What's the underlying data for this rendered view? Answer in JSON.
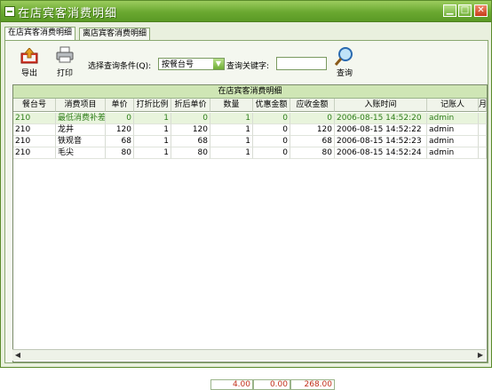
{
  "window": {
    "title": "在店宾客消费明细"
  },
  "tabs": [
    {
      "label": "在店宾客消费明细",
      "active": true
    },
    {
      "label": "离店宾客消费明细",
      "active": false
    }
  ],
  "toolbar": {
    "export_label": "导出",
    "print_label": "打印",
    "condition_label": "选择查询条件(Q):",
    "condition_value": "按餐台号",
    "keyword_label": "查询关键字:",
    "keyword_value": "",
    "query_label": "查询"
  },
  "grid": {
    "caption": "在店宾客消费明细",
    "columns": [
      "餐台号",
      "消费项目",
      "单价",
      "打折比例",
      "折后单价",
      "数量",
      "优惠金额",
      "应收金额",
      "入账时间",
      "记账人",
      "月"
    ],
    "rows": [
      [
        "210",
        "最低消费补差",
        "0",
        "1",
        "0",
        "1",
        "0",
        "0",
        "2006-08-15 14:52:20",
        "admin"
      ],
      [
        "210",
        "龙井",
        "120",
        "1",
        "120",
        "1",
        "0",
        "120",
        "2006-08-15 14:52:22",
        "admin"
      ],
      [
        "210",
        "铁观音",
        "68",
        "1",
        "68",
        "1",
        "0",
        "68",
        "2006-08-15 14:52:23",
        "admin"
      ],
      [
        "210",
        "毛尖",
        "80",
        "1",
        "80",
        "1",
        "0",
        "80",
        "2006-08-15 14:52:24",
        "admin"
      ]
    ],
    "selected_row": 0,
    "totals": {
      "quantity": "4.00",
      "discount": "0.00",
      "receivable": "268.00"
    }
  },
  "colors": {
    "accent": "#6aa830",
    "selected_text": "#2e7d1a",
    "total_text": "#c0301a"
  }
}
